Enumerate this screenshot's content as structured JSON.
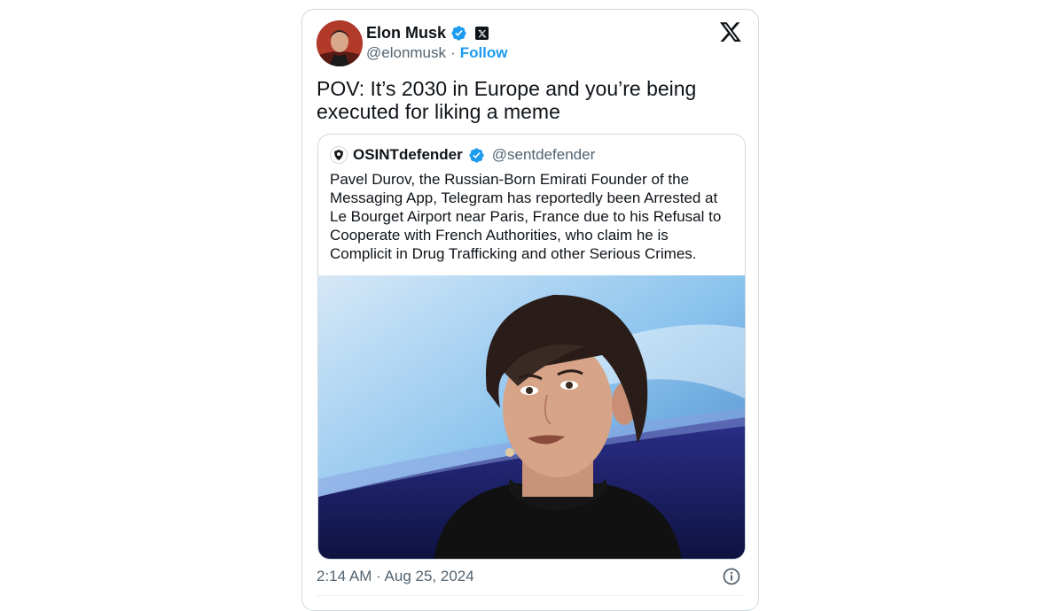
{
  "tweet": {
    "author_name": "Elon Musk",
    "author_handle": "@elonmusk",
    "separator": "·",
    "follow_label": "Follow",
    "text": "POV: It’s 2030 in Europe and you’re being executed for liking a meme",
    "timestamp": "2:14 AM · Aug 25, 2024"
  },
  "quote": {
    "author_name": "OSINTdefender",
    "author_handle": "@sentdefender",
    "text": "Pavel Durov, the Russian-Born Emirati Founder of the Messaging App, Telegram has reportedly been Arrested at Le Bourget Airport near Paris, France due to his Refusal to Cooperate with French Authorities, who claim he is Complicit in Drug Trafficking and other Serious Crimes."
  },
  "icons": {
    "verified": "verified-badge-icon",
    "affiliate": "x-affiliate-badge-icon",
    "platform": "x-logo-icon",
    "info": "info-icon"
  },
  "colors": {
    "accent": "#1d9bf0",
    "text": "#0f1419",
    "secondary": "#536471",
    "border": "#cfd9de"
  }
}
